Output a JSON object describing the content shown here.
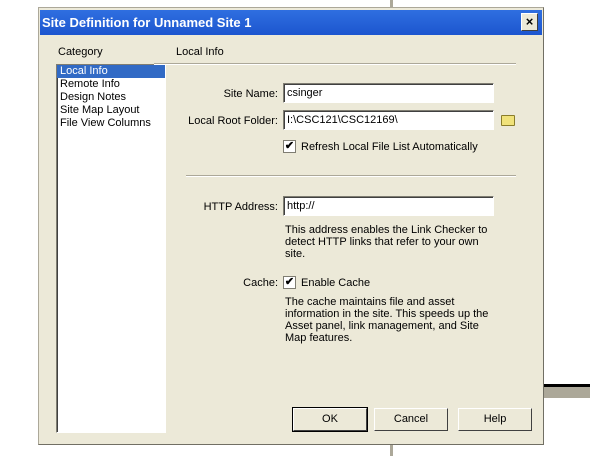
{
  "dialog": {
    "title": "Site Definition for Unnamed Site 1",
    "close_label": "×"
  },
  "category": {
    "label": "Category",
    "items": [
      "Local Info",
      "Remote Info",
      "Design Notes",
      "Site Map Layout",
      "File View Columns"
    ],
    "selected": 0
  },
  "panel": {
    "title": "Local Info",
    "site_name_label": "Site Name:",
    "site_name_value": "csinger",
    "root_folder_label": "Local Root Folder:",
    "root_folder_value": "I:\\CSC121\\CSC12169\\",
    "refresh_label": "Refresh Local File List Automatically",
    "refresh_checked": true,
    "http_label": "HTTP Address:",
    "http_value": "http://",
    "http_help": "This address enables the Link Checker to detect HTTP links that refer to your own site.",
    "cache_label": "Cache:",
    "cache_checkbox_label": "Enable Cache",
    "cache_checked": true,
    "cache_help": "The cache maintains file and asset information in the site.  This speeds up the Asset panel, link management, and Site Map features."
  },
  "buttons": {
    "ok": "OK",
    "cancel": "Cancel",
    "help": "Help"
  },
  "check_mark": "✔"
}
